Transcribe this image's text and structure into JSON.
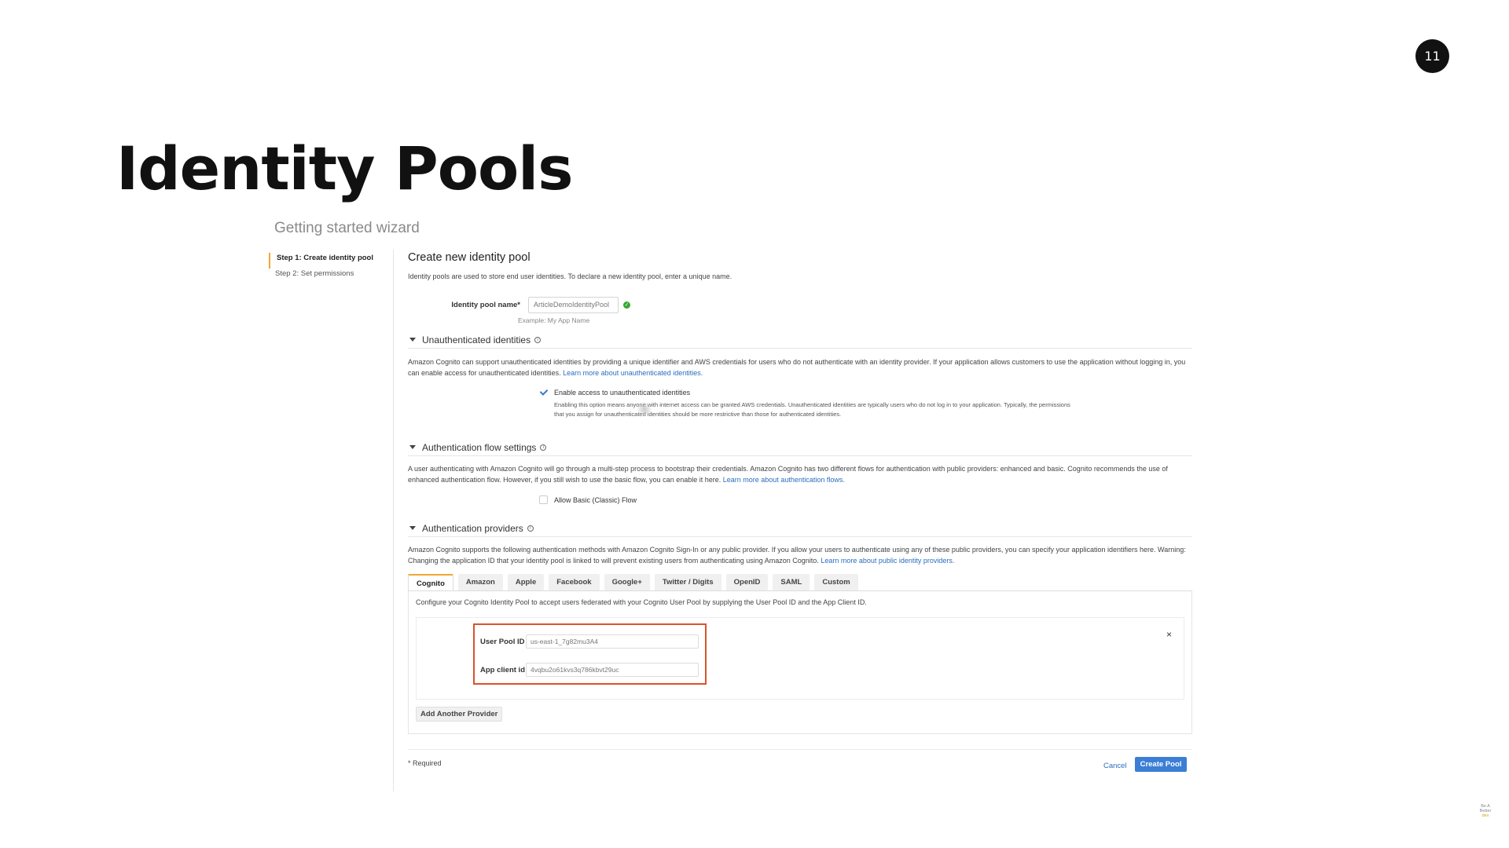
{
  "slide": {
    "number": "11",
    "title": "Identity Pools",
    "subtitle": "Getting started wizard"
  },
  "steps": [
    {
      "label": "Step 1: Create identity pool",
      "active": true
    },
    {
      "label": "Step 2: Set permissions",
      "active": false
    }
  ],
  "main": {
    "title": "Create new identity pool",
    "description": "Identity pools are used to store end user identities. To declare a new identity pool, enter a unique name.",
    "pool_name": {
      "label": "Identity pool name*",
      "value": "ArticleDemoIdentityPool",
      "hint": "Example: My App Name"
    }
  },
  "unauth": {
    "title": "Unauthenticated identities",
    "description": "Amazon Cognito can support unauthenticated identities by providing a unique identifier and AWS credentials for users who do not authenticate with an identity provider. If your application allows customers to use the application without logging in, you can enable access for unauthenticated identities.",
    "link": "Learn more about unauthenticated identities.",
    "checkbox_label": "Enable access to unauthenticated identities",
    "checked": true,
    "checkbox_note": "Enabling this option means anyone with internet access can be granted AWS credentials. Unauthenticated identities are typically users who do not log in to your application. Typically, the permissions that you assign for unauthenticated identities should be more restrictive than those for authenticated identities."
  },
  "auth_flow": {
    "title": "Authentication flow settings",
    "description": "A user authenticating with Amazon Cognito will go through a multi-step process to bootstrap their credentials. Amazon Cognito has two different flows for authentication with public providers: enhanced and basic. Cognito recommends the use of enhanced authentication flow. However, if you still wish to use the basic flow, you can enable it here.",
    "link": "Learn more about authentication flows.",
    "checkbox_label": "Allow Basic (Classic) Flow",
    "checked": false
  },
  "providers": {
    "title": "Authentication providers",
    "description": "Amazon Cognito supports the following authentication methods with Amazon Cognito Sign-In or any public provider. If you allow your users to authenticate using any of these public providers, you can specify your application identifiers here. Warning: Changing the application ID that your identity pool is linked to will prevent existing users from authenticating using Amazon Cognito.",
    "link": "Learn more about public identity providers.",
    "tabs": [
      "Cognito",
      "Amazon",
      "Apple",
      "Facebook",
      "Google+",
      "Twitter / Digits",
      "OpenID",
      "SAML",
      "Custom"
    ],
    "active_tab": "Cognito",
    "panel_description": "Configure your Cognito Identity Pool to accept users federated with your Cognito User Pool by supplying the User Pool ID and the App Client ID.",
    "user_pool_label": "User Pool ID",
    "user_pool_value": "us-east-1_7g82mu3A4",
    "app_client_label": "App client id",
    "app_client_value": "4vqbu2o61kvs3q786kbvt29uc",
    "remove_symbol": "×",
    "add_button": "Add Another Provider"
  },
  "footer": {
    "required": "* Required",
    "cancel": "Cancel",
    "create": "Create Pool"
  },
  "watermark": {
    "line1": "Be A",
    "line2": "Better",
    "line3": "dev"
  },
  "colors": {
    "accent": "#f0a830",
    "highlight": "#d9532c",
    "primary_button": "#3b7ed6",
    "link": "#2a6dbf"
  }
}
